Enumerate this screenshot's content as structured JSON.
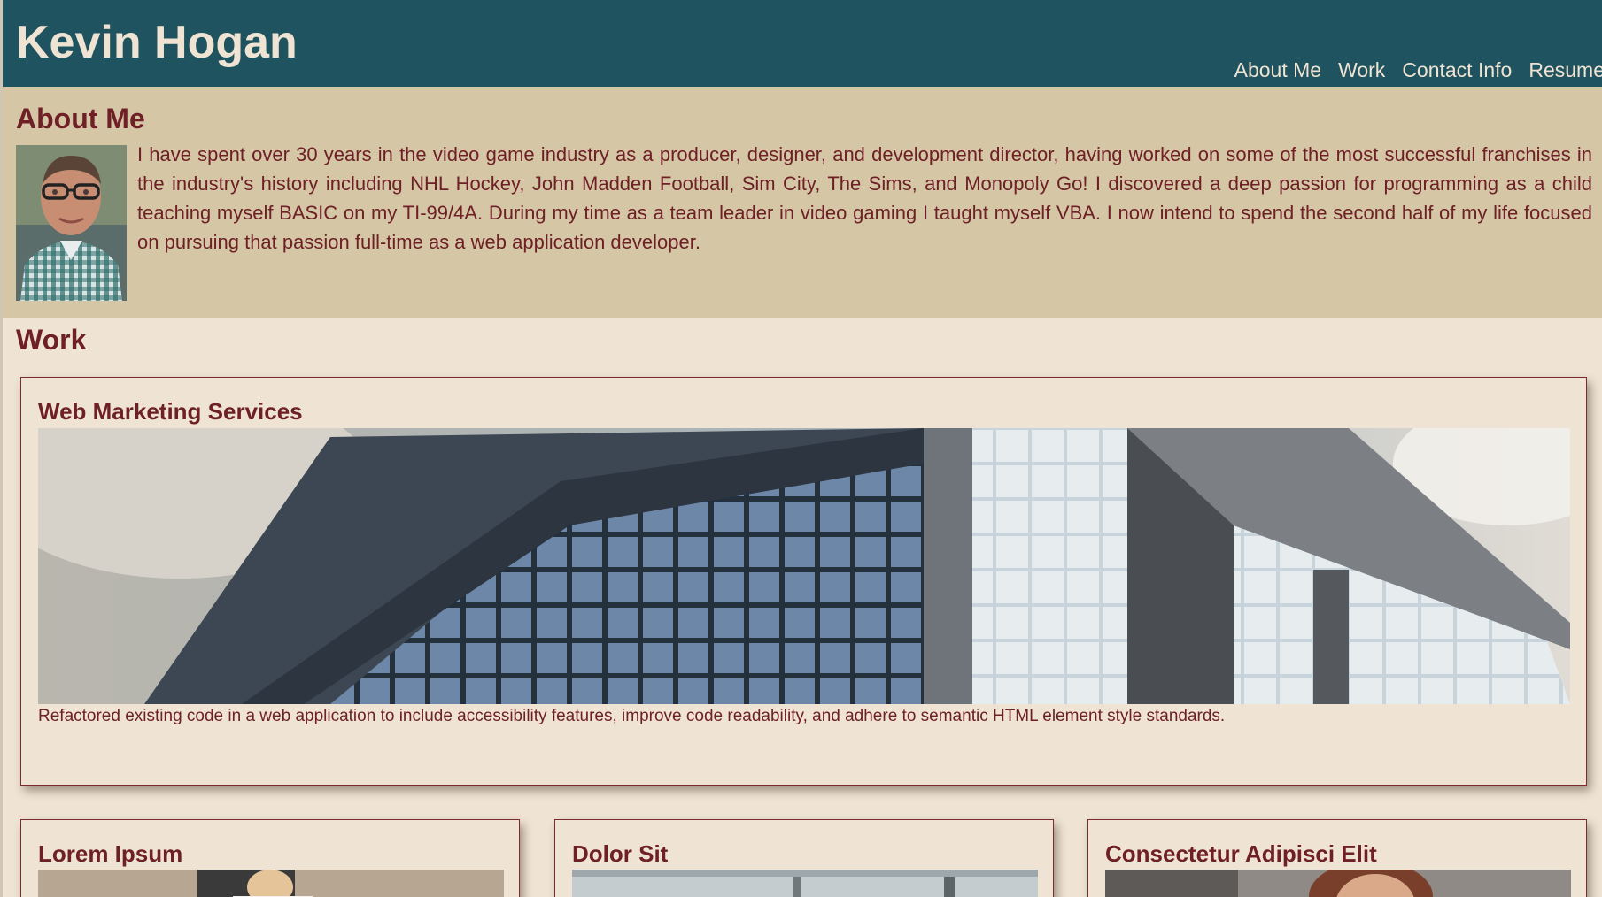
{
  "header": {
    "title": "Kevin Hogan",
    "nav": [
      "About Me",
      "Work",
      "Contact Info",
      "Resume"
    ]
  },
  "about": {
    "heading": "About Me",
    "text": "I have spent over 30 years in the video game industry as a producer, designer, and development director, having worked on some of the most successful franchises in the industry's history including NHL Hockey, John Madden Football, Sim City, The Sims, and Monopoly Go! I discovered a deep passion for programming as a child teaching myself BASIC on my TI-99/4A. During my time as a team leader in video gaming I taught myself VBA. I now intend to spend the second half of my life focused on pursuing that passion full-time as a web application developer."
  },
  "work": {
    "heading": "Work",
    "featured": {
      "title": "Web Marketing Services",
      "description": "Refactored existing code in a web application to include accessibility features, improve code readability, and adhere to semantic HTML element style standards."
    },
    "projects": [
      {
        "title": "Lorem Ipsum"
      },
      {
        "title": "Dolor Sit"
      },
      {
        "title": "Consectetur Adipisci Elit"
      }
    ]
  },
  "colors": {
    "header_bg": "#1f535f",
    "about_bg": "#d5c6a6",
    "page_bg": "#efe4d3",
    "accent_text": "#6e2026"
  }
}
